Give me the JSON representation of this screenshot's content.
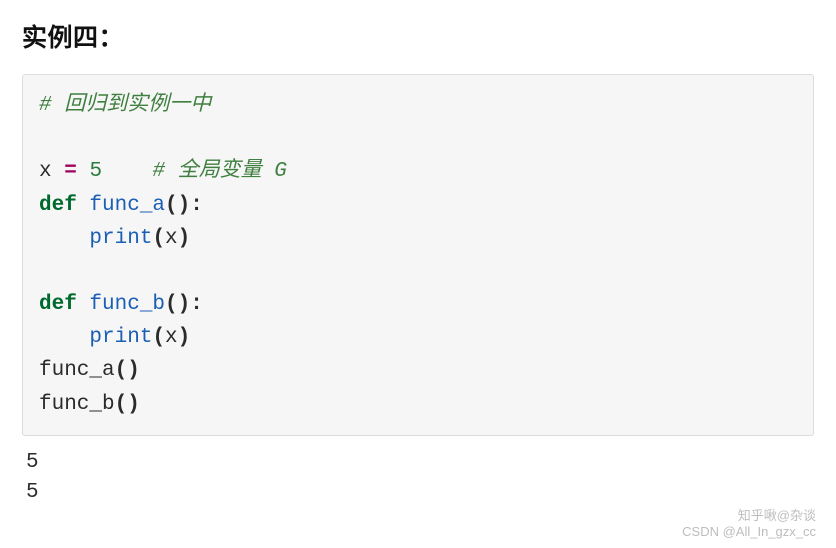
{
  "heading": "实例四：",
  "code": {
    "comment1": "# 回归到实例一中",
    "var_name": "x",
    "assign_op": "=",
    "var_value": "5",
    "comment2": "# 全局变量 G",
    "kw_def": "def",
    "func_a_name": "func_a",
    "func_b_name": "func_b",
    "paren_open": "(",
    "paren_close": ")",
    "colon": ":",
    "print_name": "print",
    "arg_x": "x",
    "call_a": "func_a",
    "call_b": "func_b"
  },
  "output": {
    "line1": "5",
    "line2": "5"
  },
  "watermark": {
    "line1": "知乎啾@杂谈",
    "line2": "CSDN @All_In_gzx_cc"
  }
}
